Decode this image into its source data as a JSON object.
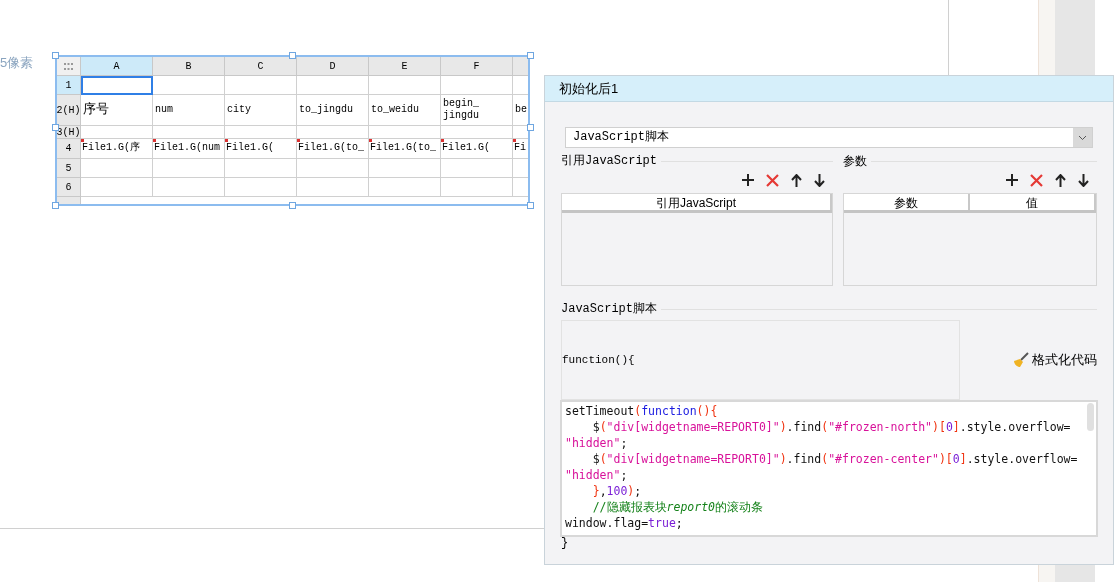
{
  "canvas": {
    "label": "5像素"
  },
  "sheet": {
    "columns": [
      {
        "label": "A",
        "selected": true
      },
      {
        "label": "B",
        "selected": false
      },
      {
        "label": "C",
        "selected": false
      },
      {
        "label": "D",
        "selected": false
      },
      {
        "label": "E",
        "selected": false
      },
      {
        "label": "F",
        "selected": false
      },
      {
        "selected": false
      }
    ],
    "rows": [
      {
        "header": "1",
        "kind": "plain",
        "selected": true,
        "cells": [
          null,
          null,
          null,
          null,
          null,
          null,
          null
        ]
      },
      {
        "header": "2(H)",
        "kind": "title",
        "selected": false,
        "cells": [
          "序号",
          "num",
          "city",
          "to_jingdu",
          "to_weidu",
          "begin_\njingdu",
          "be"
        ]
      },
      {
        "header": "3(H)",
        "kind": "plain",
        "selected": false,
        "cells": [
          null,
          null,
          null,
          null,
          null,
          null,
          null
        ]
      },
      {
        "header": "4",
        "kind": "formula",
        "selected": false,
        "cells": [
          "File1.G(序",
          "File1.G(num",
          "File1.G(",
          "File1.G(to_",
          "File1.G(to_",
          "File1.G(",
          "Fi"
        ]
      },
      {
        "header": "5",
        "kind": "plain",
        "selected": false,
        "cells": [
          null,
          null,
          null,
          null,
          null,
          null,
          null
        ]
      },
      {
        "header": "6",
        "kind": "plain",
        "selected": false,
        "cells": [
          null,
          null,
          null,
          null,
          null,
          null,
          null
        ]
      }
    ]
  },
  "dialog": {
    "title": "初始化后1",
    "type_select": {
      "value": "JavaScript脚本"
    },
    "reference": {
      "title": "引用JavaScript",
      "columns": [
        "引用JavaScript"
      ]
    },
    "parameters": {
      "title": "参数",
      "columns": [
        "参数",
        "值"
      ]
    },
    "script": {
      "title": "JavaScript脚本",
      "header": "function(){",
      "format_button": "格式化代码",
      "footer": "}",
      "lines": [
        [
          {
            "text": "setTimeout",
            "kind": "plain"
          },
          {
            "text": "(",
            "kind": "bracket"
          },
          {
            "text": "function",
            "kind": "keyword"
          },
          {
            "text": "(){",
            "kind": "bracket"
          }
        ],
        [
          {
            "text": "    $",
            "kind": "plain"
          },
          {
            "text": "(",
            "kind": "bracket"
          },
          {
            "text": "\"div[widgetname=REPORT0]\"",
            "kind": "string"
          },
          {
            "text": ")",
            "kind": "bracket"
          },
          {
            "text": ".find",
            "kind": "plain"
          },
          {
            "text": "(",
            "kind": "bracket"
          },
          {
            "text": "\"#frozen-north\"",
            "kind": "string"
          },
          {
            "text": ")[",
            "kind": "bracket"
          },
          {
            "text": "0",
            "kind": "number"
          },
          {
            "text": "]",
            "kind": "bracket"
          },
          {
            "text": ".style.overflow=",
            "kind": "plain"
          }
        ],
        [
          {
            "text": "\"hidden\"",
            "kind": "string"
          },
          {
            "text": ";",
            "kind": "plain"
          }
        ],
        [
          {
            "text": "    $",
            "kind": "plain"
          },
          {
            "text": "(",
            "kind": "bracket"
          },
          {
            "text": "\"div[widgetname=REPORT0]\"",
            "kind": "string"
          },
          {
            "text": ")",
            "kind": "bracket"
          },
          {
            "text": ".find",
            "kind": "plain"
          },
          {
            "text": "(",
            "kind": "bracket"
          },
          {
            "text": "\"#frozen-center\"",
            "kind": "string"
          },
          {
            "text": ")[",
            "kind": "bracket"
          },
          {
            "text": "0",
            "kind": "number"
          },
          {
            "text": "]",
            "kind": "bracket"
          },
          {
            "text": ".style.overflow=",
            "kind": "plain"
          }
        ],
        [
          {
            "text": "\"hidden\"",
            "kind": "string"
          },
          {
            "text": ";",
            "kind": "plain"
          }
        ],
        [
          {
            "text": "    }",
            "kind": "bracket"
          },
          {
            "text": ",",
            "kind": "plain"
          },
          {
            "text": "100",
            "kind": "number"
          },
          {
            "text": ")",
            "kind": "bracket"
          },
          {
            "text": ";",
            "kind": "plain"
          }
        ],
        [
          {
            "text": "    //隐藏报表块",
            "kind": "comment"
          },
          {
            "text": "report0",
            "kind": "comment-italic"
          },
          {
            "text": "的滚动条",
            "kind": "comment"
          }
        ],
        [
          {
            "text": "window.flag",
            "kind": "plain"
          },
          {
            "text": "=",
            "kind": "plain"
          },
          {
            "text": "true",
            "kind": "number"
          },
          {
            "text": ";",
            "kind": "plain"
          }
        ]
      ]
    }
  }
}
